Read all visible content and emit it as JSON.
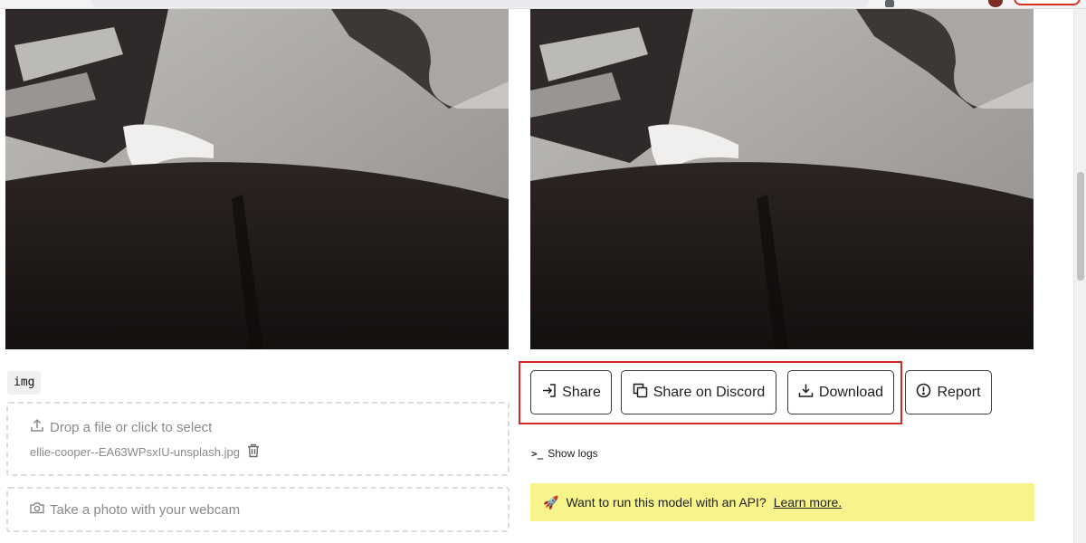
{
  "input": {
    "label": "img",
    "dropzone_text": "Drop a file or click to select",
    "filename": "ellie-cooper--EA63WPsxIU-unsplash.jpg",
    "webcam_text": "Take a photo with your webcam"
  },
  "actions": {
    "share_label": "Share",
    "discord_label": "Share on Discord",
    "download_label": "Download",
    "report_label": "Report"
  },
  "logs": {
    "prompt": ">_",
    "label": "Show logs"
  },
  "api_banner": {
    "emoji": "🚀",
    "text": "Want to run this model with an API?",
    "link": "Learn more."
  },
  "icons": {
    "upload": "upload-icon",
    "trash": "trash-icon",
    "camera": "camera-icon",
    "share": "share-arrow-icon",
    "copy": "copy-icon",
    "download": "download-icon",
    "report": "alert-circle-icon"
  },
  "colors": {
    "highlight": "#d42a2a",
    "banner": "#f7f48c"
  }
}
